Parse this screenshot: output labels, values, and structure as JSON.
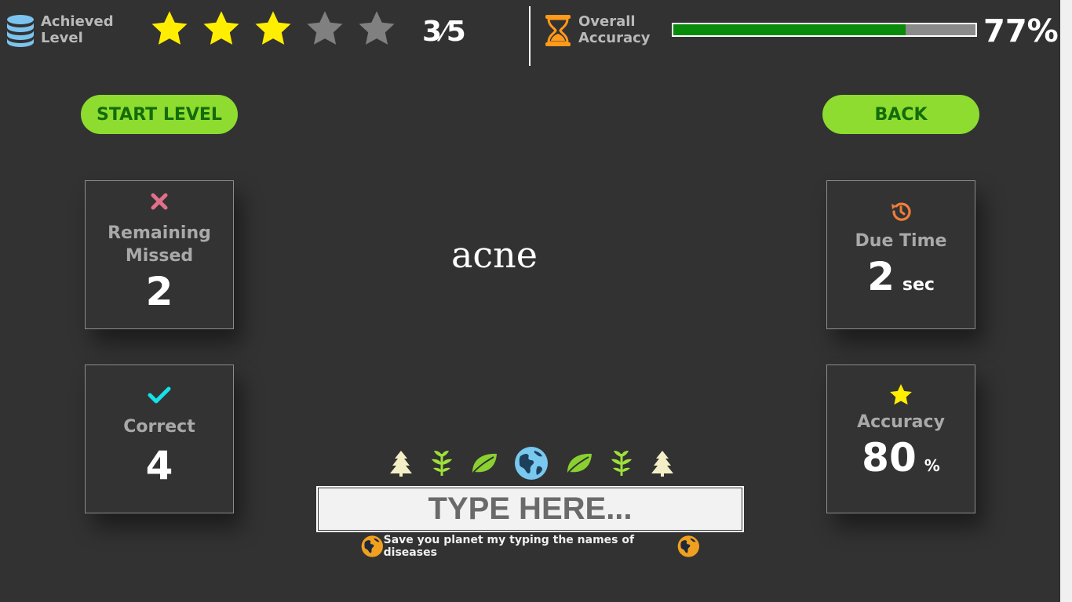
{
  "header": {
    "achieved_level_label": "Achieved\nLevel",
    "stars_filled": 3,
    "stars_total": 5,
    "level_num": "3",
    "level_den": "5",
    "overall_accuracy_label": "Overall\nAccuracy",
    "overall_accuracy_percent": "77%",
    "overall_accuracy_fraction": 0.77
  },
  "buttons": {
    "start_level": "START LEVEL",
    "back": "BACK"
  },
  "cards": {
    "remaining_missed": {
      "title": "Remaining\nMissed",
      "value": "2"
    },
    "correct": {
      "title": "Correct",
      "value": "4"
    },
    "due_time": {
      "title": "Due Time",
      "value": "2",
      "unit": "sec"
    },
    "accuracy": {
      "title": "Accuracy",
      "value": "80",
      "unit": "%"
    }
  },
  "word": "acne",
  "input": {
    "placeholder": "TYPE HERE...",
    "value": ""
  },
  "footer": {
    "text": "Save you planet my typing the names of diseases"
  },
  "colors": {
    "background": "#323232",
    "button_green": "#8ddc2f",
    "button_text": "#136b0a",
    "star_yellow": "#ffee00",
    "star_gray": "#808080",
    "progress_green": "#0a8a0a",
    "missed_x": "#e0708a",
    "correct_check": "#16e0e8",
    "hourglass": "#ff9a1a",
    "globe": "#78c8f0"
  },
  "icons": {
    "level_icon": "database-icon",
    "accuracy_icon": "hourglass-icon",
    "missed_icon": "close-icon",
    "correct_icon": "checkmark-icon",
    "due_time_icon": "history-icon",
    "accuracy_card_icon": "star-icon",
    "decor_row": [
      "tree-icon",
      "seedling-icon",
      "leaf-icon",
      "globe-icon",
      "leaf-icon",
      "seedling-icon",
      "tree-icon"
    ],
    "footer_icon": "globe-icon"
  }
}
